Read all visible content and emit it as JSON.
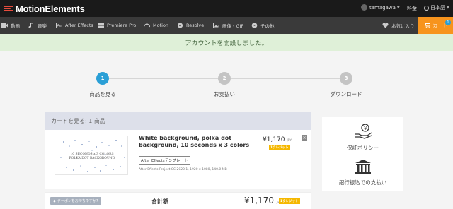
{
  "brand": {
    "name": "MotionElements"
  },
  "topbar": {
    "username": "tamagawa",
    "fee_label": "料金",
    "lang_label": "日本語"
  },
  "nav": {
    "items": [
      {
        "label": "動画",
        "icon": "video-icon"
      },
      {
        "label": "音楽",
        "icon": "music-icon"
      },
      {
        "label": "After Effects",
        "icon": "after-effects-icon"
      },
      {
        "label": "Premiere Pro",
        "icon": "premiere-pro-icon"
      },
      {
        "label": "Motion",
        "icon": "motion-icon"
      },
      {
        "label": "Resolve",
        "icon": "resolve-icon"
      },
      {
        "label": "画像・GIF",
        "icon": "image-icon"
      },
      {
        "label": "その他",
        "icon": "other-icon"
      }
    ],
    "favorites_label": "お気に入り",
    "cart_label": "カート",
    "cart_count": "1"
  },
  "notice": {
    "text": "アカウントを開設しました。"
  },
  "steps": [
    {
      "number": "1",
      "label": "商品を見る",
      "active": true
    },
    {
      "number": "2",
      "label": "お支払い",
      "active": false
    },
    {
      "number": "3",
      "label": "ダウンロード",
      "active": false
    }
  ],
  "cart": {
    "header": "カートを見る: 1 商品",
    "items": [
      {
        "title": "White background, polka dot background, 10 seconds x 3 colors",
        "thumb_text": "10 SECONDS x 3 COLORS POLKA DOT BACKGROUND",
        "tag": "After Effectsテンプレート",
        "meta": "After Effects Project CC 2020.1, 1920 x 1080, 140.0 MB",
        "price": "¥1,170",
        "price_unit": "JPY",
        "credit_label": "1クレジット"
      }
    ],
    "coupon_label": "クーポンをお持ちですか?",
    "total_label": "合計額",
    "total_price": "¥1,170",
    "total_unit": "JPY",
    "total_credit": "1クレジット"
  },
  "side": {
    "guarantee_label": "保証ポリシー",
    "bank_label": "銀行振込での支払い"
  },
  "colors": {
    "accent_blue": "#2a9fd6",
    "cart_orange": "#f7941d",
    "credit_yellow": "#f5b800",
    "notice_green": "#dff0d8"
  }
}
